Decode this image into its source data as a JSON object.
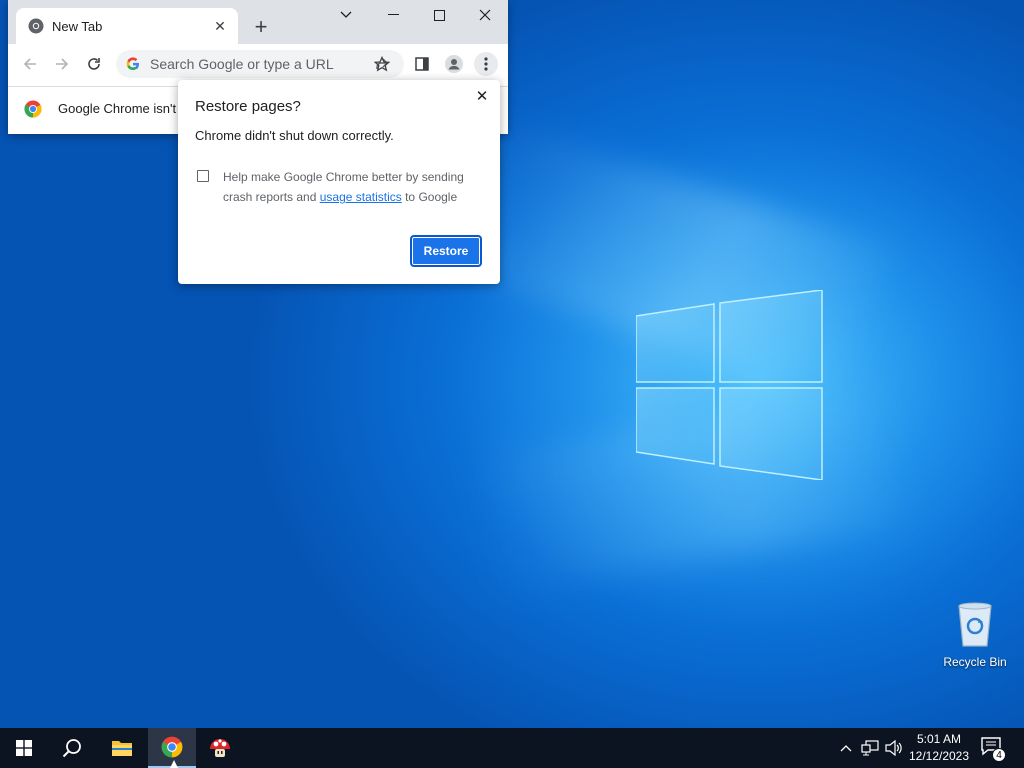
{
  "chrome": {
    "tab_title": "New Tab",
    "newtab_icon": "plus-icon",
    "window_controls": [
      "chevron-down-icon",
      "minimize-icon",
      "maximize-icon",
      "close-icon"
    ],
    "omnibox_placeholder": "Search Google or type a URL",
    "infobar_text": "Google Chrome isn't"
  },
  "dialog": {
    "title": "Restore pages?",
    "message": "Chrome didn't shut down correctly.",
    "checkbox_label_pre": "Help make Google Chrome better by sending crash reports and ",
    "checkbox_link": "usage statistics",
    "checkbox_label_post": " to Google",
    "checkbox_checked": false,
    "restore_button": "Restore"
  },
  "desktop": {
    "recycle_bin_label": "Recycle Bin"
  },
  "taskbar": {
    "apps": [
      "start-icon",
      "search-icon",
      "file-explorer-icon",
      "chrome-icon",
      "mushroom-app-icon"
    ],
    "active_app": "chrome-icon",
    "clock_time": "5:01 AM",
    "clock_date": "12/12/2023",
    "notification_count": "4"
  },
  "colors": {
    "accent": "#1a73e8",
    "taskbar": "#0c1421",
    "desktop": "#0a6fd6"
  }
}
